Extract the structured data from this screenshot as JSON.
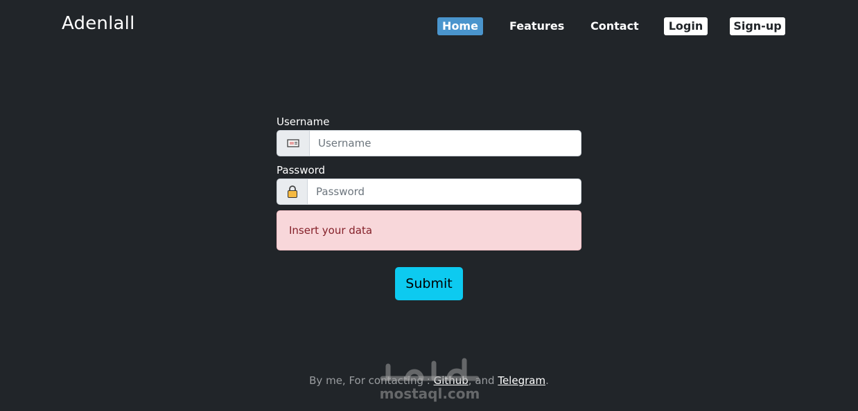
{
  "brand": {
    "title": "Adenlall"
  },
  "nav": {
    "home": "Home",
    "features": "Features",
    "contact": "Contact",
    "login": "Login",
    "signup": "Sign-up",
    "active_color": "#4a95cd"
  },
  "form": {
    "username_label": "Username",
    "username_placeholder": "Username",
    "username_icon": "id-card-icon",
    "password_label": "Password",
    "password_placeholder": "Password",
    "password_icon": "lock-icon",
    "alert_text": "Insert your data",
    "submit_label": "Submit"
  },
  "footer": {
    "prefix": "By me, For contacting : ",
    "github": "Github",
    "middle": ", and ",
    "telegram": "Telegram",
    "suffix": "."
  },
  "watermark": {
    "text": "mostaql.com",
    "arabic": "مستقل"
  },
  "colors": {
    "background": "#212529",
    "alert_bg": "#f8d7da",
    "submit_bg": "#0dcaf0"
  }
}
